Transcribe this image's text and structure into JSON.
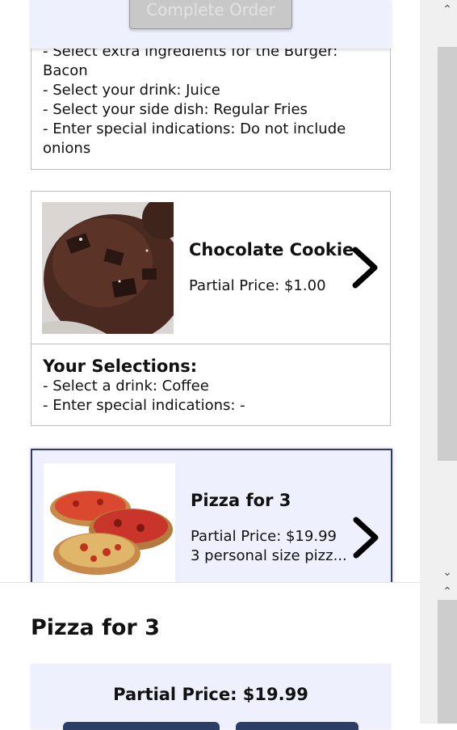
{
  "order_bar": {
    "complete_label": "Complete Order"
  },
  "burger_card": {
    "selections": "- Select extra ingredients for the Burger: Bacon\n- Select your drink: Juice\n- Select your side dish: Regular Fries\n- Enter special indications: Do not include onions"
  },
  "cookie_card": {
    "name": "Chocolate Cookie",
    "price": "Partial Price: $1.00",
    "selections_title": "Your Selections:",
    "selections": [
      "- Select a drink: Coffee",
      "- Enter special indications: -"
    ]
  },
  "pizza_card": {
    "name": "Pizza for 3",
    "price": "Partial Price: $19.99",
    "description": "3 personal size pizz..."
  },
  "detail": {
    "title": "Pizza for 3",
    "price": "Partial Price: $19.99"
  },
  "icons": {
    "next": "chevron-right-icon",
    "scroll_up": "scroll-up-arrow-icon",
    "scroll_down": "scroll-down-arrow-icon"
  },
  "colors": {
    "card_bg": "#eef1fd",
    "border": "#bdbdbd",
    "active_border": "#2d3e66",
    "button_disabled": "#c8c8c8"
  }
}
